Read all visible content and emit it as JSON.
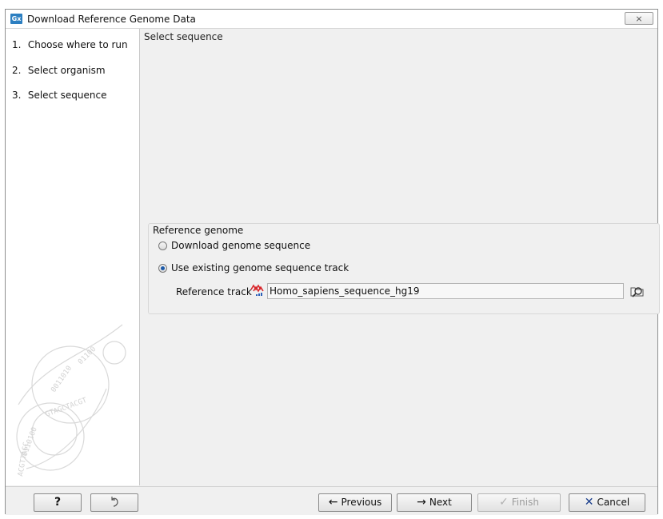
{
  "window": {
    "title": "Download Reference Genome Data",
    "app_icon": "Gx",
    "close_glyph": "⨯"
  },
  "sidebar": {
    "steps": [
      {
        "num": "1.",
        "label": "Choose where to run"
      },
      {
        "num": "2.",
        "label": "Select organism"
      },
      {
        "num": "3.",
        "label": "Select sequence"
      }
    ]
  },
  "main": {
    "section_title": "Select sequence",
    "group": {
      "label": "Reference genome",
      "options": [
        {
          "label": "Download genome sequence",
          "checked": false
        },
        {
          "label": "Use existing genome sequence track",
          "checked": true
        }
      ],
      "reference_label": "Reference track",
      "reference_value": "Homo_sapiens_sequence_hg19",
      "track_icon": "sequence-track-icon",
      "browse_icon": "browse-folder-icon"
    }
  },
  "footer": {
    "help_label": "?",
    "reset_icon": "undo-icon",
    "previous_label": "Previous",
    "next_label": "Next",
    "finish_label": "Finish",
    "cancel_label": "Cancel",
    "finish_enabled": false
  },
  "colors": {
    "accent": "#2c7fc1",
    "radio_selected": "#1d5aa8",
    "cancel_x": "#1a3e8c",
    "track_icon_red": "#d8262b"
  }
}
